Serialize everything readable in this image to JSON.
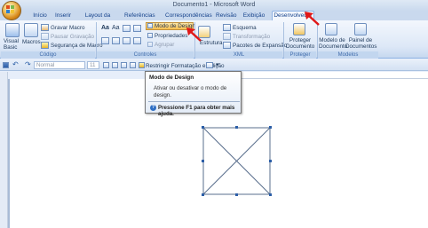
{
  "window": {
    "title": "Documento1 - Microsoft Word"
  },
  "tabs": [
    {
      "label": "Início"
    },
    {
      "label": "Inserir"
    },
    {
      "label": "Layout da Página"
    },
    {
      "label": "Referências"
    },
    {
      "label": "Correspondências"
    },
    {
      "label": "Revisão"
    },
    {
      "label": "Exibição"
    },
    {
      "label": "Desenvolvedor"
    }
  ],
  "ribbon": {
    "codigo": {
      "visual_basic": "Visual Basic",
      "macros": "Macros",
      "gravar_macro": "Gravar Macro",
      "pausar_gravacao": "Pausar Gravação",
      "seguranca_macro": "Segurança de Macro",
      "label": "Código"
    },
    "controles": {
      "modo_design": "Modo de Design",
      "propriedades": "Propriedades",
      "agrupar": "Agrupar",
      "label": "Controles"
    },
    "xml": {
      "estrutura": "Estrutura",
      "esquema": "Esquema",
      "transformacao": "Transformação",
      "pacotes": "Pacotes de Expansão",
      "label": "XML"
    },
    "proteger": {
      "proteger_doc": "Proteger Documento",
      "label": "Proteger"
    },
    "modelos": {
      "modelo_doc": "Modelo de Documento",
      "painel_doc": "Painel de Documentos",
      "label": "Modelos"
    }
  },
  "format_bar": {
    "style_value": "Normal",
    "font_size_value": "11",
    "clear_format": "Restringir Formatação e Edição"
  },
  "tooltip": {
    "title": "Modo de Design",
    "description": "Ativar ou desativar o modo de design.",
    "help": "Pressione F1 para obter mais ajuda."
  },
  "colors": {
    "accent_highlight": "#f8c050",
    "arrow_red": "#e01818",
    "ribbon_bg": "#dde8f7"
  }
}
